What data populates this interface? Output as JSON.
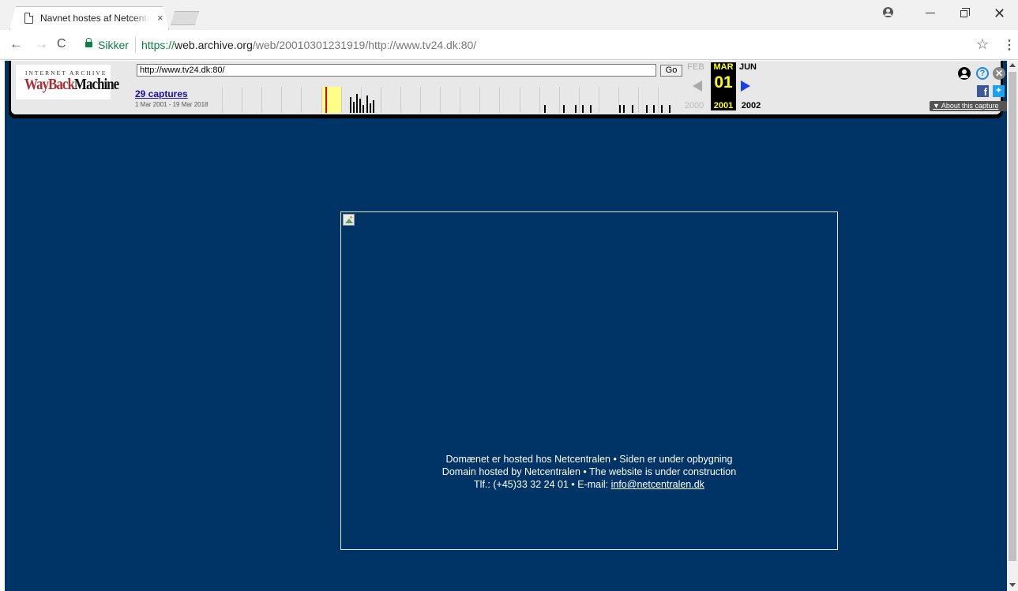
{
  "browser": {
    "tab_title": "Navnet hostes af Netcentralen",
    "tab_close": "×",
    "nav": {
      "back": "←",
      "forward": "→",
      "reload": "C"
    },
    "secure_label": "Sikker",
    "url": {
      "scheme": "https://",
      "host": "web.archive.org",
      "path": "/web/20010301231919/http://www.tv24.dk:80/"
    },
    "star": "☆",
    "menu": "⋮",
    "close_window": "✕"
  },
  "wayback": {
    "logo_top": "INTERNET ARCHIVE",
    "logo_main_a": "WayBack",
    "logo_main_b": "Machine",
    "url_input_value": "http://www.tv24.dk:80/",
    "go_label": "Go",
    "captures_label": "29 captures",
    "captures_range": "1 Mar 2001 - 19 Mar 2018",
    "months": {
      "prev": "FEB",
      "current": "MAR",
      "next": "JUN"
    },
    "day": "01",
    "years": {
      "prev": "2000",
      "current": "2001",
      "next": "2002"
    },
    "help_icon_glyph": "?",
    "close_icon_glyph": "✕",
    "facebook_glyph": "f",
    "twitter_glyph": "🐦",
    "about_label": "▼ About this capture",
    "sparkline_highlight_color": "#ffff88"
  },
  "page": {
    "background_color": "#003366",
    "lines": [
      "Domænet er hosted hos Netcentralen • Siden er under opbygning",
      "Domain hosted by Netcentralen • The website is under construction"
    ],
    "contact_prefix": "Tlf.: (+45)33 32 24 01 • E-mail: ",
    "email": "info@netcentralen.dk"
  }
}
